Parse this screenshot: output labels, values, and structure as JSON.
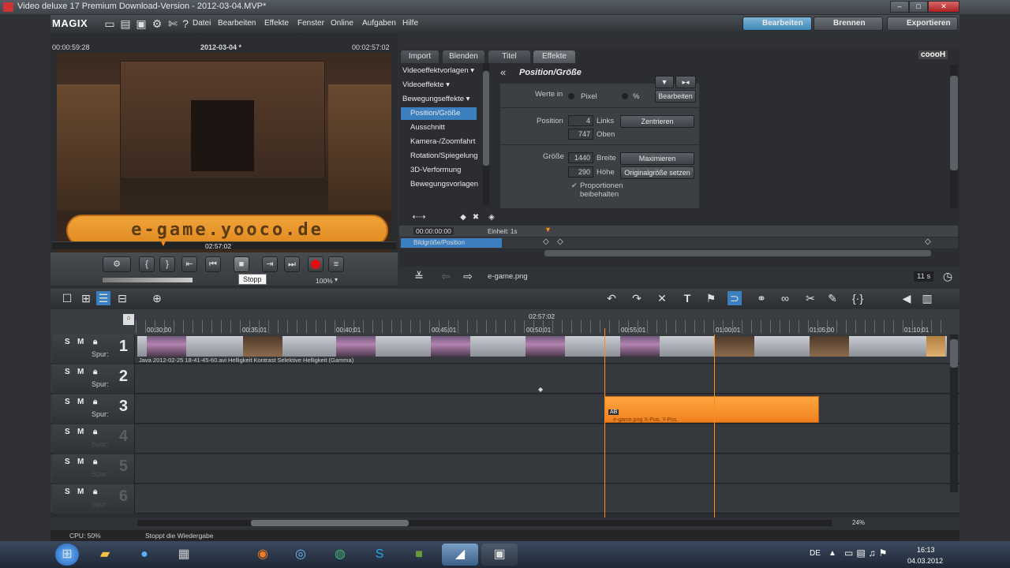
{
  "window": {
    "title": "Video deluxe 17 Premium Download-Version - 2012-03-04.MVP*",
    "min": "–",
    "max": "□",
    "close": "✕"
  },
  "menubar": {
    "logo": "MAGIX",
    "items": [
      "Datei",
      "Bearbeiten",
      "Effekte",
      "Fenster",
      "Online",
      "Aufgaben",
      "Hilfe"
    ],
    "modes": [
      {
        "label": "Bearbeiten",
        "active": true
      },
      {
        "label": "Brennen",
        "active": false
      },
      {
        "label": "Exportieren",
        "active": false
      }
    ]
  },
  "preview": {
    "timecode_left": "00:00:59:28",
    "title": "2012-03-04 *",
    "timecode_right": "00:02:57:02",
    "overlay_text": "e-game.yooco.de",
    "scrub_time": "02:57:02",
    "zoom": "100%",
    "tooltip": "Stopp"
  },
  "effects": {
    "tabs": [
      {
        "label": "Import",
        "active": false
      },
      {
        "label": "Blenden",
        "active": false
      },
      {
        "label": "Titel",
        "active": false
      },
      {
        "label": "Effekte",
        "active": true
      }
    ],
    "brand": "coooH",
    "list": [
      {
        "label": "Videoeffektvorlagen",
        "arrow": "▾",
        "sub": false,
        "sel": false
      },
      {
        "label": "Videoeffekte",
        "arrow": "▾",
        "sub": false,
        "sel": false
      },
      {
        "label": "Bewegungseffekte",
        "arrow": "▾",
        "sub": false,
        "sel": false
      },
      {
        "label": "Position/Größe",
        "sub": true,
        "sel": true
      },
      {
        "label": "Ausschnitt",
        "sub": true,
        "sel": false
      },
      {
        "label": "Kamera-/Zoomfahrt",
        "sub": true,
        "sel": false
      },
      {
        "label": "Rotation/Spiegelung",
        "sub": true,
        "sel": false
      },
      {
        "label": "3D-Verformung",
        "sub": true,
        "sel": false
      },
      {
        "label": "Bewegungsvorlagen",
        "sub": true,
        "sel": false
      }
    ],
    "panel_title": "Position/Größe",
    "werte_in": "Werte in",
    "opt_pixel": "Pixel",
    "opt_percent": "%",
    "bearbeiten": "Bearbeiten",
    "position_label": "Position",
    "pos_x": "4",
    "pos_x_unit": "Links",
    "pos_y": "747",
    "pos_y_unit": "Oben",
    "zentrieren": "Zentrieren",
    "groesse_label": "Größe",
    "size_w": "1440",
    "size_w_unit": "Breite",
    "size_h": "290",
    "size_h_unit": "Höhe",
    "maximieren": "Maximieren",
    "original": "Originalgröße setzen",
    "proportionen": "Proportionen",
    "beibehalten": "beibehalten",
    "kf_time": "00:00:00:00",
    "kf_unit": "Einheit: 1s",
    "kf_track": "Bildgröße/Position",
    "file": "e-game.png",
    "duration": "11 s"
  },
  "timeline": {
    "header_time": "02:57:02",
    "ruler": [
      "00:30;00",
      "00:35;01",
      "00:40;01",
      "00:45;01",
      "00:50;01",
      "00:55;01",
      "01:00;01",
      "01:05;00",
      "01:10;01"
    ],
    "tracks": [
      {
        "n": "1",
        "spur": "Spur:"
      },
      {
        "n": "2",
        "spur": "Spur:"
      },
      {
        "n": "3",
        "spur": "Spur:"
      },
      {
        "n": "4",
        "spur": "Spur:"
      },
      {
        "n": "5",
        "spur": "Spur:"
      },
      {
        "n": "6",
        "spur": "Spur:"
      }
    ],
    "track_s": "S",
    "track_m": "M",
    "clip1_label": "Java 2012-02-25 18-41-45-60.avi  Helligkeit  Kontrast  Selektive Helligkeit (Gamma)",
    "clip3_label": "e-game.png  X-Pos.  Y-Pos.",
    "clip3_badge": "AB",
    "zoom": "24%"
  },
  "status": {
    "cpu": "CPU: 50%",
    "msg": "Stoppt die Wiedergabe"
  },
  "taskbar": {
    "lang": "DE",
    "time": "16:13",
    "date": "04.03.2012"
  }
}
